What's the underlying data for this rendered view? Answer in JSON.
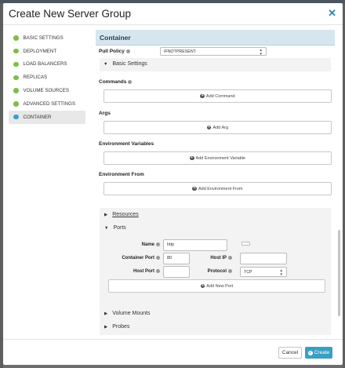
{
  "modal": {
    "title": "Create New Server Group",
    "close_icon": "close-icon"
  },
  "sidebar": {
    "items": [
      {
        "label": "BASIC SETTINGS",
        "active": false
      },
      {
        "label": "DEPLOYMENT",
        "active": false
      },
      {
        "label": "LOAD BALANCERS",
        "active": false
      },
      {
        "label": "REPLICAS",
        "active": false
      },
      {
        "label": "VOLUME SOURCES",
        "active": false
      },
      {
        "label": "ADVANCED SETTINGS",
        "active": false
      },
      {
        "label": "CONTAINER",
        "active": true
      }
    ],
    "status_color_done": "#7dbd4a",
    "status_color_active": "#3d9ecf"
  },
  "container": {
    "section_title": "Container",
    "pull_policy": {
      "label": "Pull Policy",
      "value": "IFNOTPRESENT"
    },
    "basic_settings_label": "Basic Settings",
    "commands": {
      "label": "Commands",
      "add_label": "Add Command"
    },
    "args": {
      "label": "Args",
      "add_label": "Add Arg"
    },
    "env_vars": {
      "label": "Environment Variables",
      "add_label": "Add Environment Variable"
    },
    "env_from": {
      "label": "Environment From",
      "add_label": "Add Environment From"
    },
    "resources_label": "Resources",
    "ports": {
      "label": "Ports",
      "name_label": "Name",
      "name_value": "http",
      "container_port_label": "Container Port",
      "container_port_value": "80",
      "host_ip_label": "Host IP",
      "host_ip_value": "",
      "host_port_label": "Host Port",
      "host_port_value": "",
      "protocol_label": "Protocol",
      "protocol_value": "TCP",
      "add_label": "Add New Port"
    },
    "volume_mounts_label": "Volume Mounts",
    "probes_label": "Probes"
  },
  "footer": {
    "cancel_label": "Cancel",
    "create_label": "Create"
  },
  "colors": {
    "accent": "#3a9fc4",
    "section_header_bg": "#d6e6ef",
    "link": "#2f84b5"
  }
}
